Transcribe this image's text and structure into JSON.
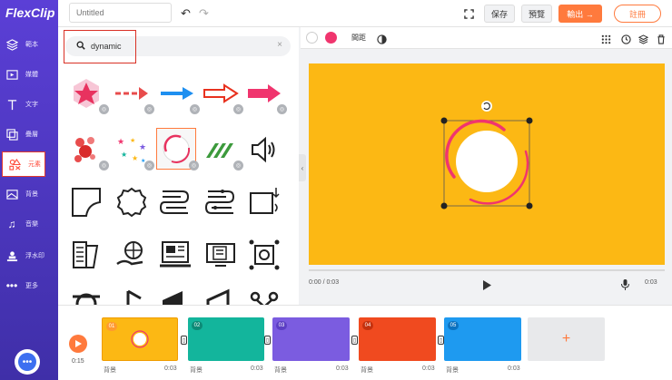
{
  "app": {
    "logo": "FlexClip"
  },
  "sidebar": {
    "items": [
      {
        "label": "範本",
        "icon": "layers-icon"
      },
      {
        "label": "媒體",
        "icon": "media-icon"
      },
      {
        "label": "文字",
        "icon": "text-icon"
      },
      {
        "label": "疊層",
        "icon": "overlay-icon"
      },
      {
        "label": "元素",
        "icon": "elements-icon",
        "active": true
      },
      {
        "label": "背景",
        "icon": "background-icon"
      },
      {
        "label": "音樂",
        "icon": "music-icon"
      },
      {
        "label": "浮水印",
        "icon": "watermark-icon"
      },
      {
        "label": "更多",
        "icon": "more-icon"
      }
    ]
  },
  "topbar": {
    "title_placeholder": "Untitled",
    "save_label": "保存",
    "preview_label": "預覽",
    "export_label": "輸出 →",
    "register_label": "註冊"
  },
  "search": {
    "value": "dynamic"
  },
  "editor_toolbar": {
    "spacing_label": "間距"
  },
  "player": {
    "time": "0:00 / 0:03",
    "duration": "0:03"
  },
  "timeline": {
    "total": "0:15",
    "clips": [
      {
        "num": "01",
        "label": "背景",
        "time": "0:03",
        "color": "#fcb814"
      },
      {
        "num": "02",
        "label": "背景",
        "time": "0:03",
        "color": "#13b59c"
      },
      {
        "num": "03",
        "label": "背景",
        "time": "0:03",
        "color": "#7b5ce0"
      },
      {
        "num": "04",
        "label": "背景",
        "time": "0:03",
        "color": "#f04a1f"
      },
      {
        "num": "05",
        "label": "背景",
        "time": "0:03",
        "color": "#1e9af0"
      }
    ],
    "add_label": "+"
  },
  "colors": {
    "accent": "#ff7a3d",
    "canvas": "#fcb814",
    "pink": "#f0356e"
  }
}
